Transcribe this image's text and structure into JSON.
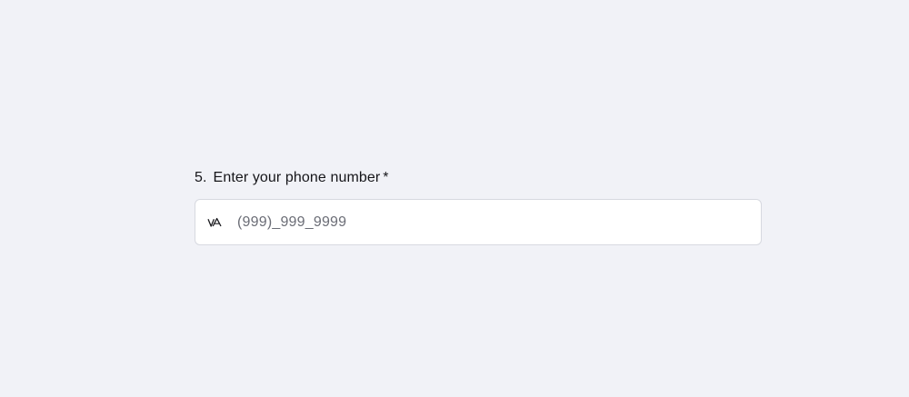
{
  "question": {
    "number": "5.",
    "label": "Enter your phone number",
    "required_mark": "*"
  },
  "phone_field": {
    "country_icon": "vietnam-flag-icon",
    "placeholder": "(999)_999_9999",
    "value": ""
  },
  "colors": {
    "page_background": "#f1f2f7",
    "field_background": "#ffffff",
    "field_border": "#d7d9e0",
    "placeholder_text": "#6b6d76"
  }
}
